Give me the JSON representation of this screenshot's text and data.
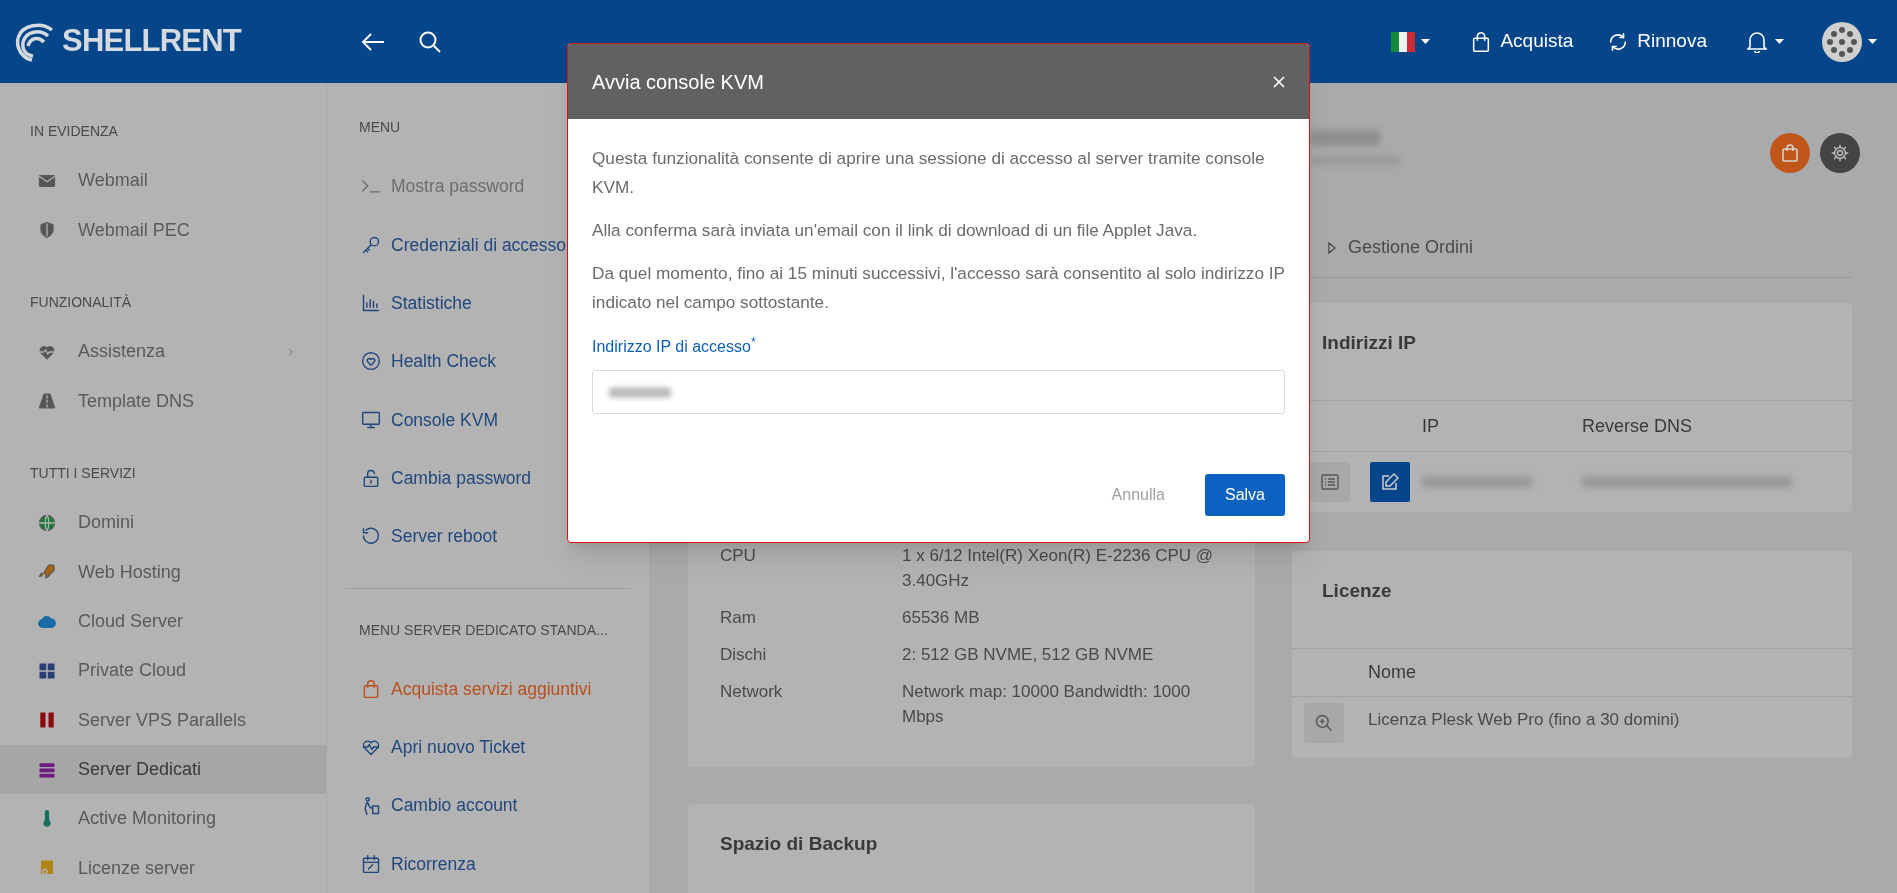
{
  "header": {
    "logo": "SHELLRENT",
    "buy": "Acquista",
    "renew": "Rinnova"
  },
  "sidebar": {
    "sections": [
      {
        "title": "IN EVIDENZA",
        "items": [
          {
            "label": "Webmail",
            "selected": false,
            "submenu": false
          },
          {
            "label": "Webmail PEC",
            "selected": false,
            "submenu": false
          }
        ]
      },
      {
        "title": "FUNZIONALITÀ",
        "items": [
          {
            "label": "Assistenza",
            "selected": false,
            "submenu": true
          },
          {
            "label": "Template DNS",
            "selected": false,
            "submenu": false
          }
        ]
      },
      {
        "title": "TUTTI I SERVIZI",
        "items": [
          {
            "label": "Domini",
            "selected": false,
            "submenu": false
          },
          {
            "label": "Web Hosting",
            "selected": false,
            "submenu": false
          },
          {
            "label": "Cloud Server",
            "selected": false,
            "submenu": false
          },
          {
            "label": "Private Cloud",
            "selected": false,
            "submenu": false
          },
          {
            "label": "Server VPS Parallels",
            "selected": false,
            "submenu": false
          },
          {
            "label": "Server Dedicati",
            "selected": true,
            "submenu": false
          },
          {
            "label": "Active Monitoring",
            "selected": false,
            "submenu": false
          },
          {
            "label": "Licenze server",
            "selected": false,
            "submenu": false
          }
        ]
      }
    ]
  },
  "menu": {
    "sections": [
      {
        "title": "MENU",
        "items": [
          {
            "label": "Mostra password",
            "disabled": true,
            "highlighted": false
          },
          {
            "label": "Credenziali di accesso",
            "disabled": false,
            "highlighted": false
          },
          {
            "label": "Statistiche",
            "disabled": false,
            "highlighted": false
          },
          {
            "label": "Health Check",
            "disabled": false,
            "highlighted": false
          },
          {
            "label": "Console KVM",
            "disabled": false,
            "highlighted": false
          },
          {
            "label": "Cambia password",
            "disabled": false,
            "highlighted": false
          },
          {
            "label": "Server reboot",
            "disabled": false,
            "highlighted": false
          }
        ]
      },
      {
        "title": "MENU SERVER DEDICATO STANDA...",
        "items": [
          {
            "label": "Acquista servizi aggiuntivi",
            "disabled": false,
            "highlighted": true
          },
          {
            "label": "Apri nuovo Ticket",
            "disabled": false,
            "highlighted": false
          },
          {
            "label": "Cambio account",
            "disabled": false,
            "highlighted": false
          },
          {
            "label": "Ricorrenza",
            "disabled": false,
            "highlighted": false
          }
        ]
      }
    ]
  },
  "details": {
    "specs": [
      {
        "label": "CPU",
        "value": "1 x 6/12 Intel(R) Xeon(R) E-2236 CPU @ 3.40GHz"
      },
      {
        "label": "Ram",
        "value": "65536 MB"
      },
      {
        "label": "Dischi",
        "value": "2: 512 GB NVME, 512 GB NVME"
      },
      {
        "label": "Network",
        "value": "Network map: 10000 Bandwidth: 1000 Mbps"
      }
    ]
  },
  "backup": {
    "title": "Spazio di Backup"
  },
  "tabs": [
    {
      "label": "Gestione Ordini"
    }
  ],
  "ip_card": {
    "title": "Indirizzi IP",
    "columns": [
      "IP",
      "Reverse DNS"
    ]
  },
  "licenses": {
    "title": "Licenze",
    "columns": [
      "Nome"
    ],
    "rows": [
      {
        "name": "Licenza Plesk Web Pro (fino a 30 domini)"
      }
    ]
  },
  "modal": {
    "title": "Avvia console KVM",
    "paragraphs": [
      "Questa funzionalità consente di aprire una sessione di accesso al server tramite console KVM.",
      "Alla conferma sarà inviata un'email con il link di download di un file Applet Java.",
      "Da quel momento, fino ai 15 minuti successivi, l'accesso sarà consentito al solo indirizzo IP indicato nel campo sottostante."
    ],
    "field_label": "Indirizzo IP di accesso$^{*}$",
    "cancel": "Annulla",
    "save": "Salva"
  }
}
